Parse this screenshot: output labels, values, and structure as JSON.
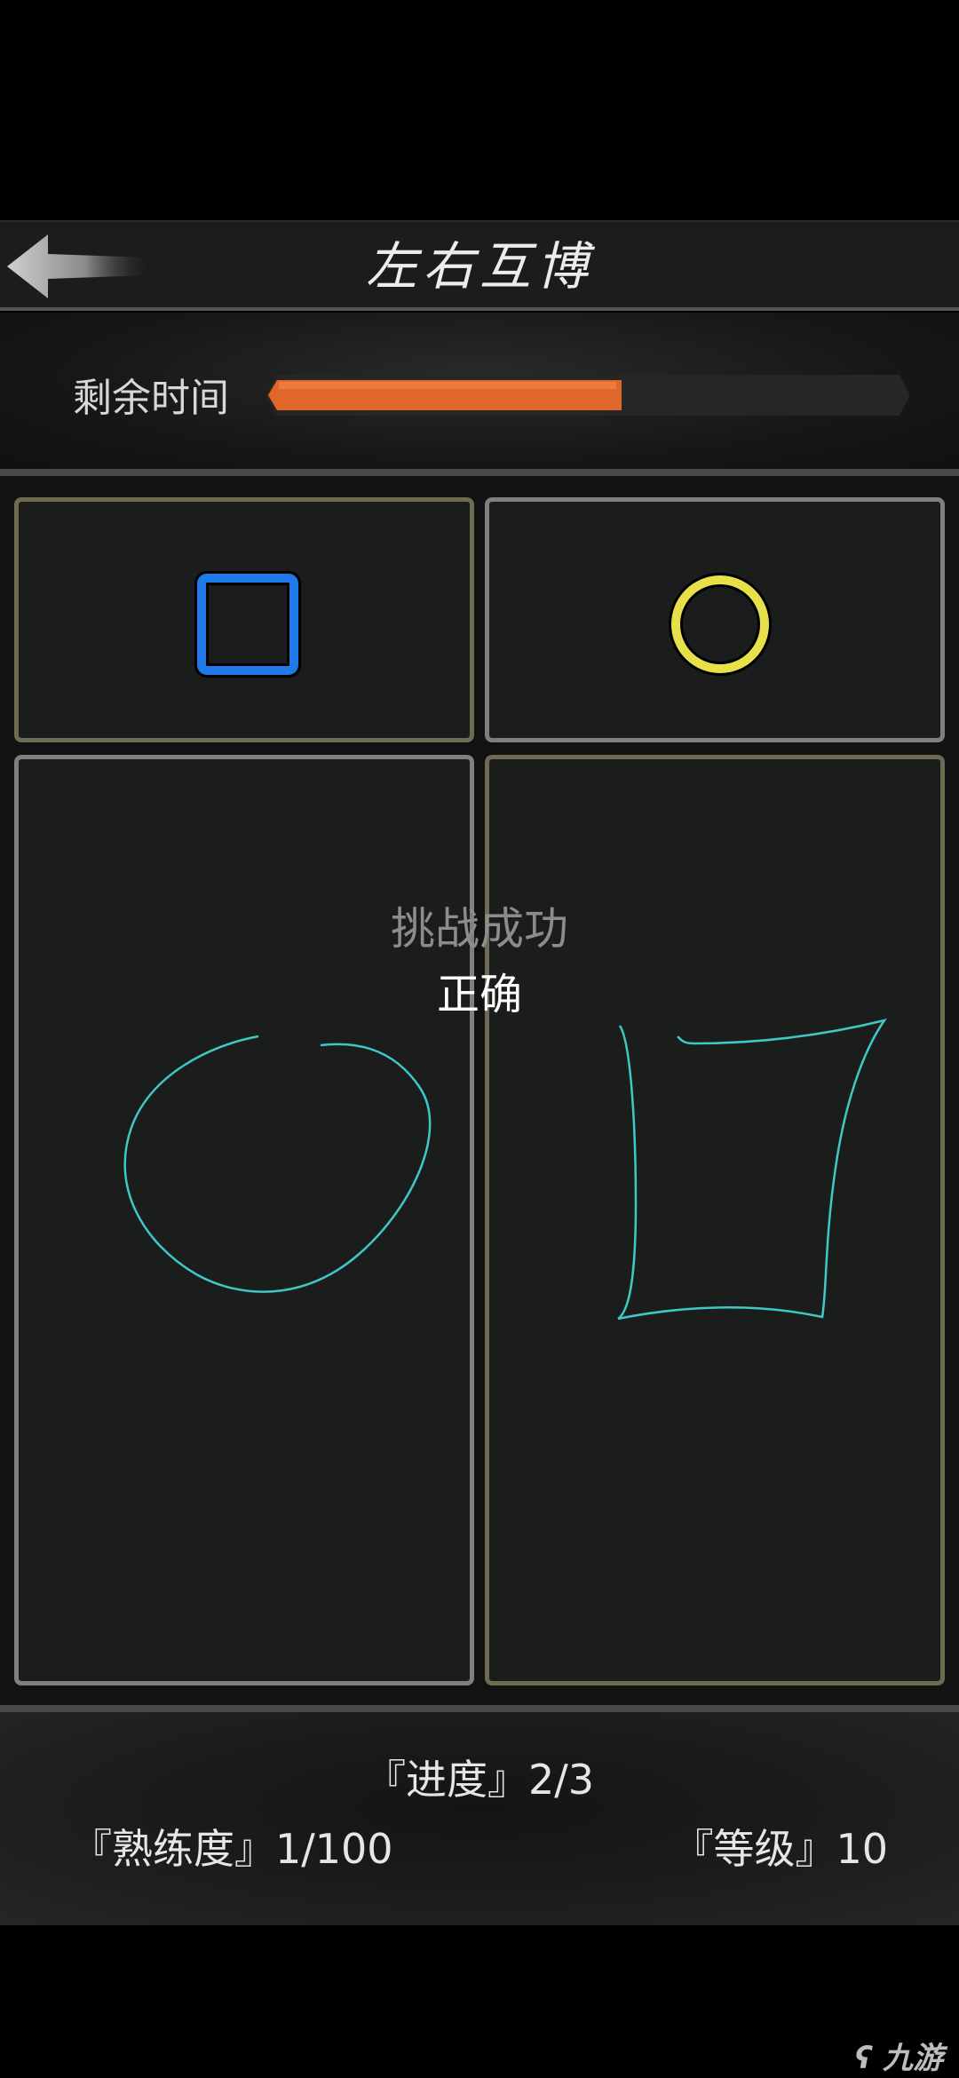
{
  "header": {
    "title": "左右互博"
  },
  "timer": {
    "label": "剩余时间",
    "remaining_fraction": 0.55,
    "fill_color": "#e0662a",
    "track_color": "#262626"
  },
  "targets": {
    "left_shape": "square-icon",
    "left_color": "#1f7ae8",
    "right_shape": "circle-icon",
    "right_color": "#e8e04a"
  },
  "drawing": {
    "stroke_color": "#3ec9c6"
  },
  "result": {
    "title": "挑战成功",
    "subtitle": "正确"
  },
  "stats": {
    "progress": "『进度』2/3",
    "proficiency": "『熟练度』1/100",
    "level": "『等级』10"
  },
  "watermark": {
    "text": "九游"
  }
}
